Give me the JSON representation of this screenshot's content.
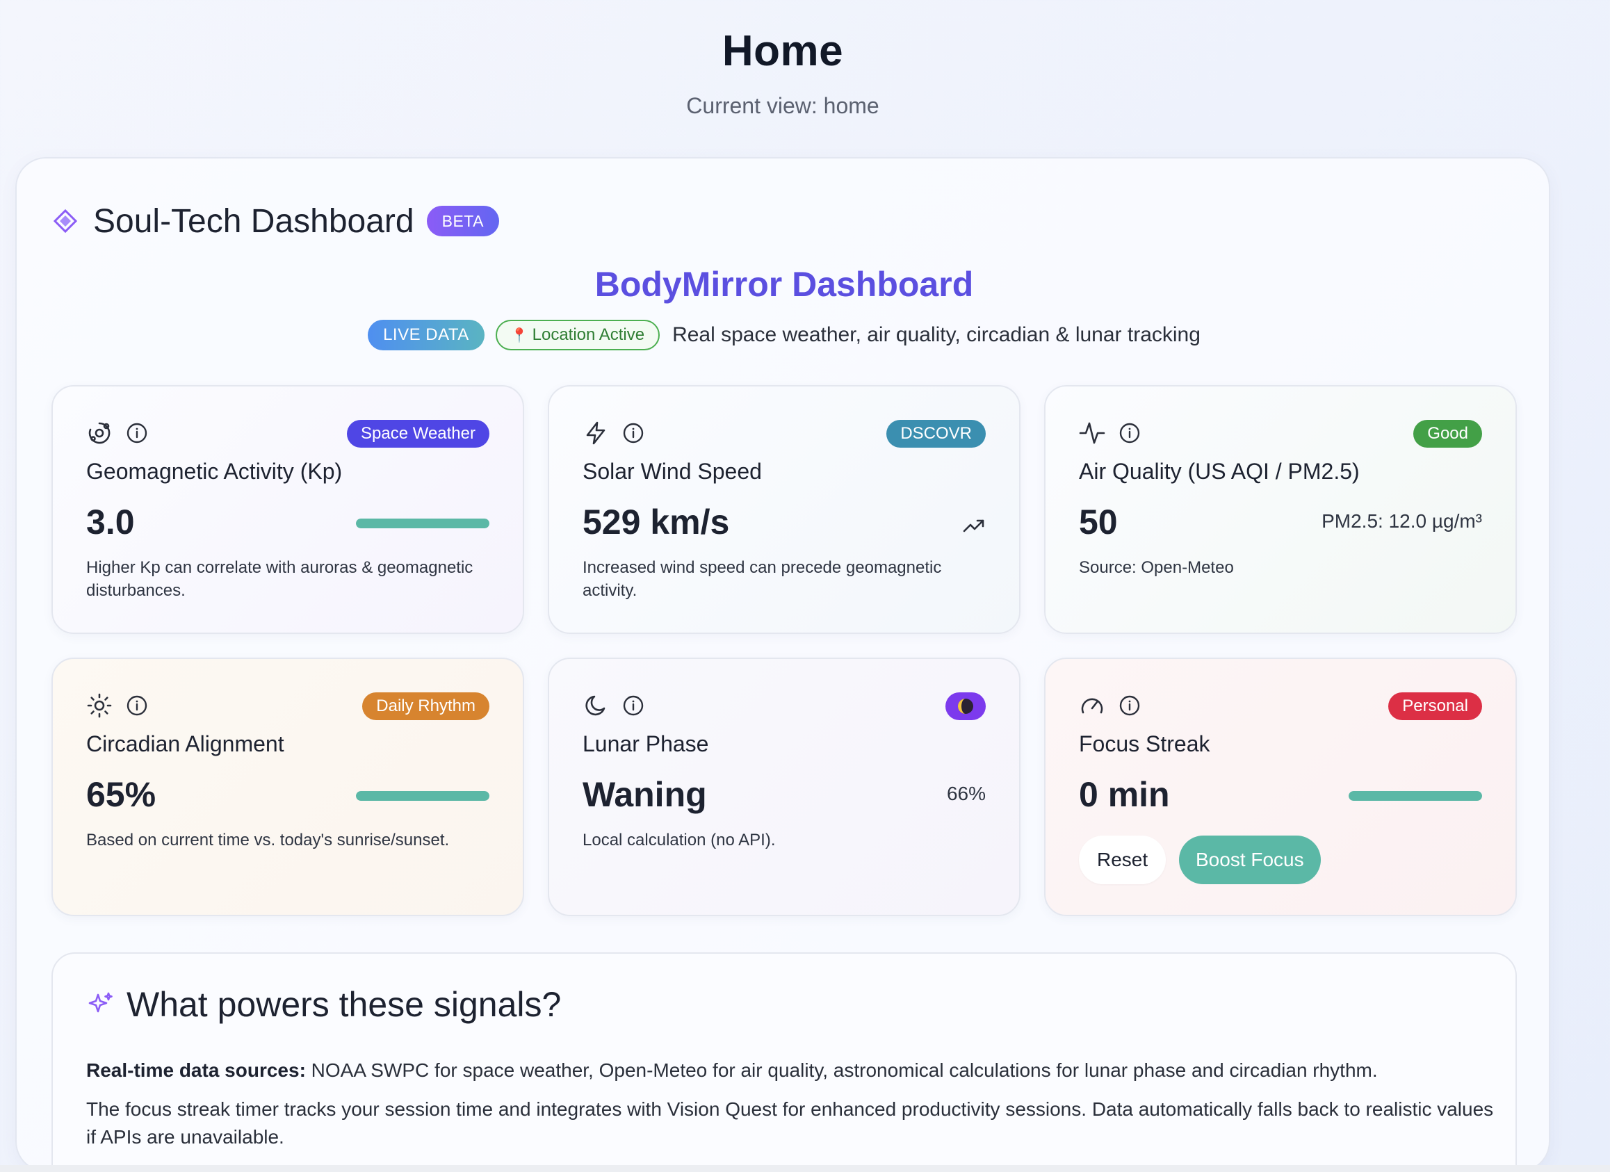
{
  "page": {
    "title": "Home",
    "subtitle": "Current view: home"
  },
  "panel": {
    "title": "Soul-Tech Dashboard",
    "badge": "BETA"
  },
  "dashboard": {
    "title": "BodyMirror Dashboard",
    "live_badge": "LIVE DATA",
    "location_badge": "Location Active",
    "description": "Real space weather, air quality, circadian & lunar tracking"
  },
  "cards": [
    {
      "title": "Geomagnetic Activity (Kp)",
      "tag": "Space Weather",
      "tag_color": "#4f46e5",
      "value": "3.0",
      "progress": 1.0,
      "note": "Higher Kp can correlate with auroras & geomagnetic disturbances.",
      "icon": "orbit-icon"
    },
    {
      "title": "Solar Wind Speed",
      "tag": "DSCOVR",
      "tag_color": "#3b8fb0",
      "value": "529 km/s",
      "note": "Increased wind speed can precede geomagnetic activity.",
      "icon": "zap-icon"
    },
    {
      "title": "Air Quality (US AQI / PM2.5)",
      "tag": "Good",
      "tag_color": "#43a047",
      "value": "50",
      "right": "PM2.5: 12.0 µg/m³",
      "note": "Source: Open-Meteo",
      "icon": "activity-icon"
    },
    {
      "title": "Circadian Alignment",
      "tag": "Daily Rhythm",
      "tag_color": "#d7842f",
      "value": "65%",
      "progress": 1.0,
      "note": "Based on current time vs. today's sunrise/sunset.",
      "icon": "sun-icon"
    },
    {
      "title": "Lunar Phase",
      "tag_color": "#7c3aed",
      "value": "Waning",
      "right": "66%",
      "note": "Local calculation (no API).",
      "icon": "moon-icon"
    },
    {
      "title": "Focus Streak",
      "tag": "Personal",
      "tag_color": "#dc2f45",
      "value": "0 min",
      "progress": 1.0,
      "reset_label": "Reset",
      "boost_label": "Boost Focus",
      "icon": "gauge-icon"
    }
  ],
  "info": {
    "title": "What powers these signals?",
    "p1_bold": "Real-time data sources:",
    "p1_rest": " NOAA SWPC for space weather, Open-Meteo for air quality, astronomical calculations for lunar phase and circadian rhythm.",
    "p2": "The focus streak timer tracks your session time and integrates with Vision Quest for enhanced productivity sessions. Data automatically falls back to realistic values if APIs are unavailable."
  },
  "colors": {
    "accent": "#5b4fe0",
    "teal": "#5bb8a6"
  }
}
